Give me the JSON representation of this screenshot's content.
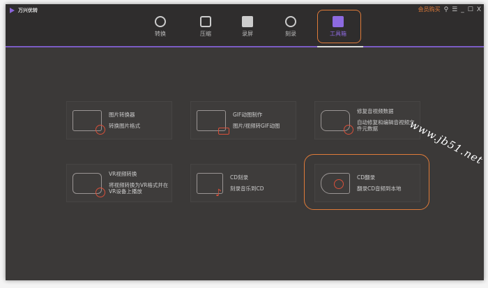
{
  "app": {
    "title": "万兴优转"
  },
  "controls": {
    "buy": "会员购买",
    "key": "⚲",
    "menu": "☰",
    "min": "_",
    "max": "☐",
    "close": "X"
  },
  "tabs": [
    {
      "label": "转换",
      "icon": "convert-icon"
    },
    {
      "label": "压缩",
      "icon": "compress-icon"
    },
    {
      "label": "录屏",
      "icon": "record-icon"
    },
    {
      "label": "刻录",
      "icon": "burn-icon"
    },
    {
      "label": "工具箱",
      "icon": "toolbox-icon",
      "active": true
    }
  ],
  "tools": [
    {
      "title": "图片转换器",
      "desc": "转换图片格式",
      "icon": "image-convert-icon"
    },
    {
      "title": "GIF动图制作",
      "desc": "图片/视频转GIF动图",
      "icon": "gif-icon"
    },
    {
      "title": "修复音视频数据",
      "desc": "自动修复和编辑音视频文件元数据",
      "icon": "repair-icon"
    },
    {
      "title": "VR视频转换",
      "desc": "将视频转换为VR格式并在VR设备上播放",
      "icon": "vr-icon"
    },
    {
      "title": "CD刻录",
      "desc": "刻录音乐到CD",
      "icon": "cd-burn-icon"
    },
    {
      "title": "CD翻录",
      "desc": "翻录CD音频到本地",
      "icon": "cd-rip-icon"
    }
  ],
  "colors": {
    "accent": "#8d6ae0",
    "highlight": "#e07b39",
    "background": "#3b3938"
  },
  "watermark": "www.jb51.net"
}
